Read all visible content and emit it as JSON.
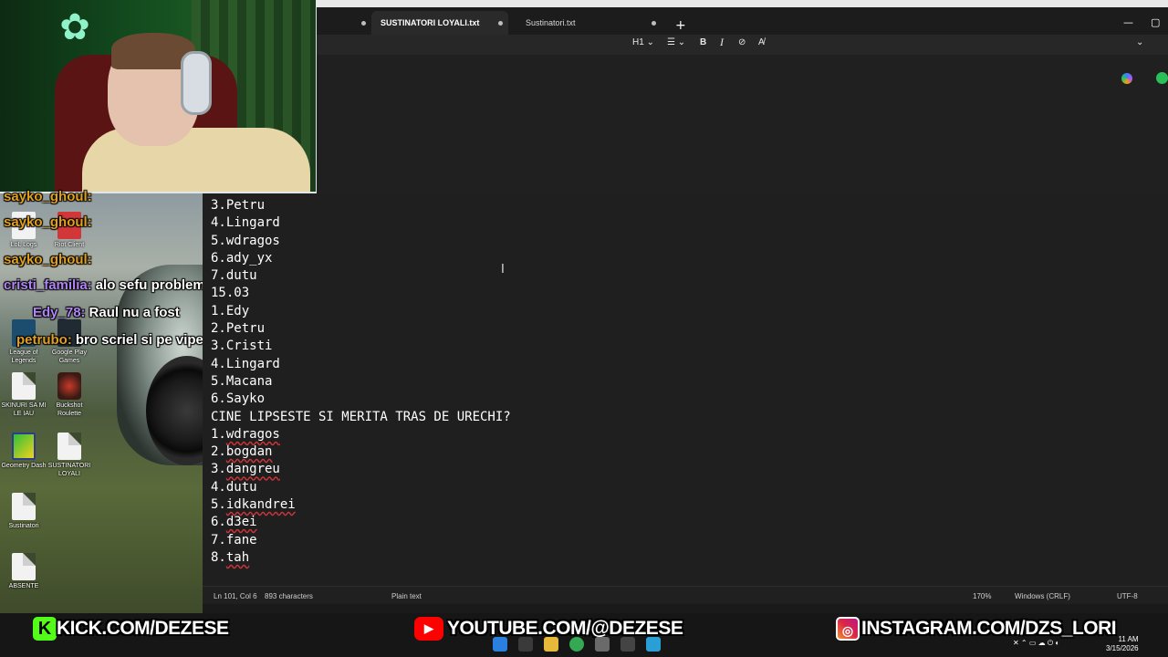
{
  "notepad": {
    "tabs": [
      {
        "label": "SUSTINATORI LOYALI.txt",
        "active": true
      },
      {
        "label": "Sustinatori.txt",
        "active": false
      }
    ],
    "toolbar": {
      "heading": "H1",
      "bold": "B",
      "italic": "I"
    },
    "lines": [
      {
        "text": "3.Petru"
      },
      {
        "text": "4.Lingard"
      },
      {
        "text": "5.wdragos"
      },
      {
        "text": "6.ady_yx"
      },
      {
        "text": "7.dutu"
      },
      {
        "text": "15.03"
      },
      {
        "text": "1.Edy"
      },
      {
        "text": "2.Petru"
      },
      {
        "text": "3.Cristi"
      },
      {
        "text": "4.Lingard"
      },
      {
        "text": "5.Macana"
      },
      {
        "text": "6.Sayko"
      },
      {
        "text": "CINE LIPSESTE SI MERITA TRAS DE URECHI?"
      },
      {
        "text": "1.wdragos",
        "prefix": "1.",
        "word": "wdragos",
        "flagged": true
      },
      {
        "text": "2.bogdan",
        "prefix": "2.",
        "word": "bogdan",
        "flagged": true
      },
      {
        "text": "3.dangreu",
        "prefix": "3.",
        "word": "dangreu",
        "flagged": true
      },
      {
        "text": "4.dutu"
      },
      {
        "text": "5.idkandrei",
        "prefix": "5.",
        "word": "idkandrei",
        "flagged": true
      },
      {
        "text": "6.d3ei",
        "prefix": "6.",
        "word": "d3ei",
        "flagged": true
      },
      {
        "text": "7.fane"
      },
      {
        "text": "8.tah",
        "prefix": "8.",
        "word": "tah",
        "flagged": true
      }
    ],
    "status": {
      "position": "Ln 101, Col 6",
      "characters": "893 characters",
      "format": "Plain text",
      "zoom": "170%",
      "line_ending": "Windows (CRLF)",
      "encoding": "UTF-8"
    }
  },
  "chat": [
    {
      "user": "sayko_ghoul:",
      "text": "",
      "color": "#e0a020"
    },
    {
      "user": "sayko_ghoul:",
      "text": "",
      "color": "#e0a020"
    },
    {
      "user": "sayko_ghoul:",
      "text": "",
      "color": "#e0a020"
    },
    {
      "user": "cristi_familia:",
      "text": "alo sefu probleme",
      "color": "#b084f5"
    },
    {
      "user": "Edy_78:",
      "text": "Raul nu a fost",
      "color": "#b084f5"
    },
    {
      "user": "petrubo:",
      "text": "bro scriel si pe vipex ca afost pe live",
      "color": "#e0a020"
    }
  ],
  "desktop_icons": [
    {
      "label": "LoL Logs",
      "icon": "app-icon"
    },
    {
      "label": "Riot Client",
      "icon": "app-icon"
    },
    {
      "label": "League of Legends",
      "icon": "lol-icon"
    },
    {
      "label": "Google Play Games",
      "icon": "play-games-icon"
    },
    {
      "label": "SKINURI SA MI LE IAU",
      "icon": "text-file-icon"
    },
    {
      "label": "Buckshot Roulette",
      "icon": "game-icon"
    },
    {
      "label": "Geometry Dash",
      "icon": "game-icon"
    },
    {
      "label": "SUSTINATORI LOYALI",
      "icon": "text-file-icon"
    },
    {
      "label": "Sustinatori",
      "icon": "text-file-icon"
    },
    {
      "label": "ABSENTE",
      "icon": "text-file-icon"
    }
  ],
  "banner": {
    "kick": "KICK.COM/DEZESE",
    "youtube": "YOUTUBE.COM/@DEZESE",
    "instagram": "INSTAGRAM.COM/DZS_LORI"
  },
  "taskbar": {
    "time": "11 AM",
    "date": "3/15/2026"
  },
  "colors": {
    "editor_bg": "#1f1f1f",
    "kick_green": "#53fc18",
    "youtube_red": "#ff0000",
    "spellcheck_red": "#d13438"
  }
}
